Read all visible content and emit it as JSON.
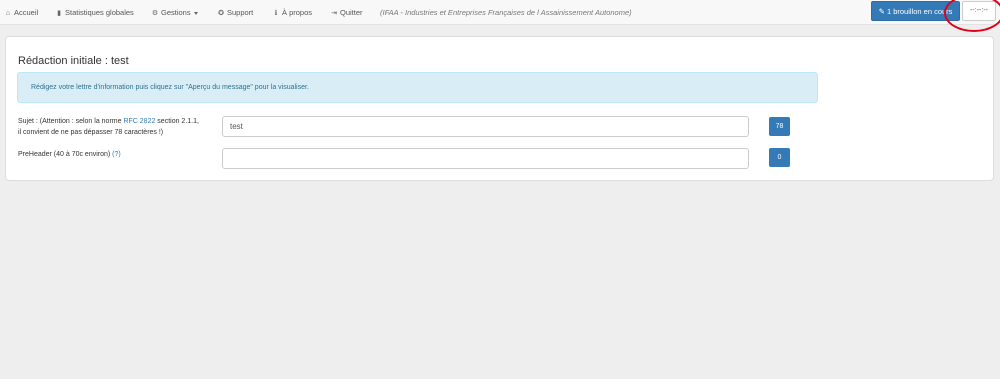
{
  "nav": {
    "home": "Accueil",
    "stats": "Statistiques globales",
    "manage": "Gestions",
    "support": "Support",
    "about": "À propos",
    "quit": "Quitter",
    "tagline": "(IFAA - Industries et Entreprises Françaises de l Assainissement Autonome)",
    "draft_button": "1 brouillon en cours",
    "timer": "--:--:--"
  },
  "icons": {
    "home": "home-icon",
    "stats": "bar-chart-icon",
    "manage": "gear-icon",
    "support": "lifebuoy-icon",
    "about": "info-icon",
    "quit": "sign-out-icon",
    "draft": "pencil-icon"
  },
  "panel": {
    "title": "Rédaction initiale : test",
    "info": "Rédigez votre lettre d'information puis cliquez sur \"Aperçu du message\" pour la visualiser."
  },
  "subject": {
    "label_prefix": "Sujet : (Attention : selon la norme ",
    "label_link": "RFC 2822",
    "label_suffix": " section 2.1.1, il convient de ne pas dépasser 78 caractères !)",
    "value": "test",
    "count": "78"
  },
  "preheader": {
    "label": "PreHeader (40 à 70c environ) ",
    "help_link": "(?)",
    "value": "",
    "count": "0"
  },
  "colors": {
    "primary": "#337ab7",
    "info_bg": "#d9edf7",
    "info_text": "#31708f",
    "annotation": "#e0001b"
  }
}
